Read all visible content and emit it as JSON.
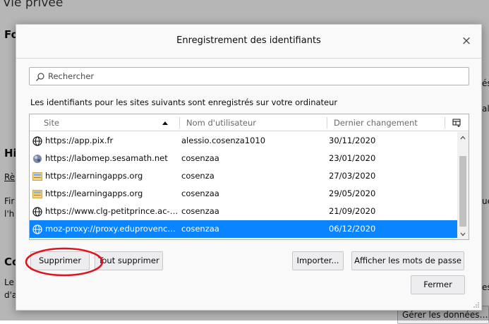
{
  "background": {
    "page_title": "Vie privée",
    "fragments": [
      {
        "text": "Fo",
        "style": "heading"
      },
      {
        "text": "Hi",
        "style": "heading"
      },
      {
        "text": "Rè",
        "style": "link"
      },
      {
        "text": "Fir",
        "style": "text"
      },
      {
        "text": "l'h",
        "style": "text"
      },
      {
        "text": "Co",
        "style": "heading"
      },
      {
        "text": "Le",
        "style": "text"
      },
      {
        "text": "d'a",
        "style": "text"
      },
      {
        "text": "és",
        "style": "text"
      },
      {
        "text": "al",
        "style": "text"
      },
      {
        "text": "ue",
        "style": "text"
      },
      {
        "text": "es",
        "style": "text"
      }
    ],
    "bottom_button": "Gérer les données…"
  },
  "dialog": {
    "title": "Enregistrement des identifiants",
    "close_symbol": "×",
    "search": {
      "placeholder": "Rechercher",
      "value": ""
    },
    "info_text": "Les identifiants pour les sites suivants sont enregistrés sur votre ordinateur",
    "table": {
      "columns": {
        "site": "Site",
        "username": "Nom d'utilisateur",
        "last_changed": "Dernier changement"
      },
      "sort": {
        "column": "site",
        "direction": "ascending"
      },
      "rows": [
        {
          "site": "https://app.pix.fr",
          "username": "alessio.cosenza1010",
          "date": "30/11/2020",
          "icon": "globe-icon",
          "selected": false
        },
        {
          "site": "https://labomep.sesamath.net",
          "username": "cosenzaa",
          "date": "23/01/2020",
          "icon": "site-favicon-labomep",
          "selected": false
        },
        {
          "site": "https://learningapps.org",
          "username": "cosenza",
          "date": "27/03/2020",
          "icon": "site-favicon-learningapps",
          "selected": false
        },
        {
          "site": "https://learningapps.org",
          "username": "cosenzaa",
          "date": "29/05/2020",
          "icon": "site-favicon-learningapps",
          "selected": false
        },
        {
          "site": "https://www.clg-petitprince.ac-aix...",
          "username": "cosenzaa",
          "date": "21/09/2020",
          "icon": "globe-icon",
          "selected": false
        },
        {
          "site": "moz-proxy://proxy.eduprovence.f...",
          "username": "cosenzaa",
          "date": "06/12/2020",
          "icon": "globe-icon",
          "selected": true
        }
      ]
    },
    "buttons": {
      "delete": "Supprimer",
      "delete_all": "Tout supprimer",
      "import": "Importer...",
      "show_passwords": "Afficher les mots de passe",
      "close": "Fermer"
    },
    "colors": {
      "selection": "#0a84ff",
      "annotation": "#e0141e"
    }
  }
}
